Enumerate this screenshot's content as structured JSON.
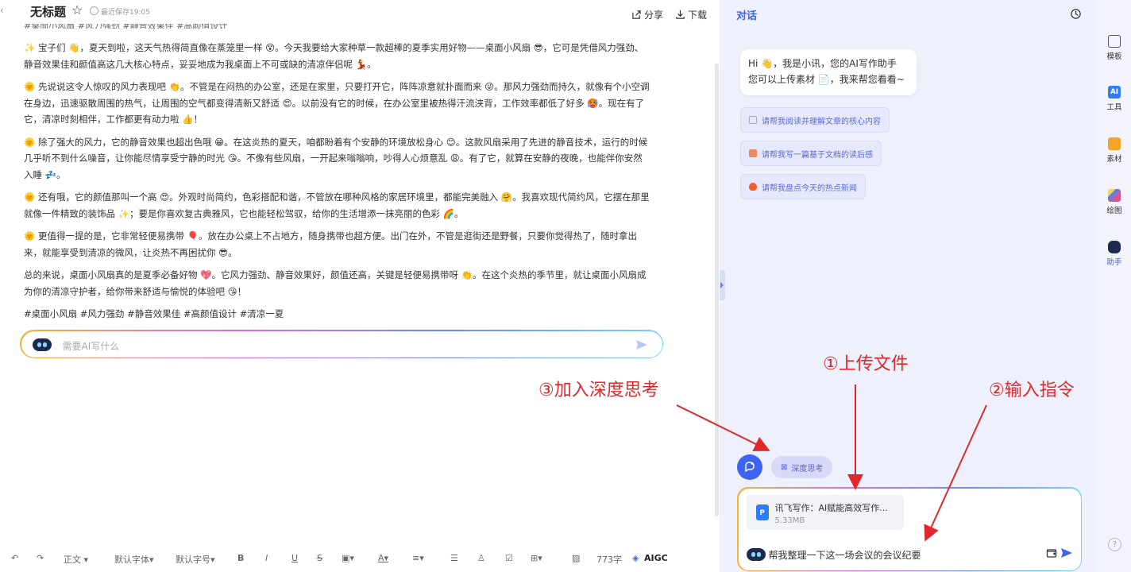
{
  "editor": {
    "title": "无标题",
    "save_note": "最近保存19:05",
    "share_label": "分享",
    "download_label": "下载",
    "cut_line": "#桌面小风扇 #风力强劲 #静音效果佳 #高颜值设计",
    "paragraphs": [
      "✨ 宝子们 👋，夏天到啦，这天气热得简直像在蒸笼里一样 😵。今天我要给大家种草一款超棒的夏季实用好物——桌面小风扇 😎，它可是凭借风力强劲、静音效果佳和颜值高这几大核心特点，妥妥地成为我桌面上不可或缺的清凉伴侣呢 💃。",
      "🌞 先说说这令人惊叹的风力表现吧 👏。不管是在闷热的办公室，还是在家里，只要打开它，阵阵凉意就扑面而来 😜。那风力强劲而持久，就像有个小空调在身边，迅速驱散周围的热气，让周围的空气都变得清新又舒适 😍。以前没有它的时候，在办公室里被热得汗流浃背，工作效率都低了好多 🥵。现在有了它，清凉时刻相伴，工作都更有动力啦 👍！",
      "🌞 除了强大的风力，它的静音效果也超出色哦 😁。在这炎热的夏天，咱都盼着有个安静的环境放松身心 😊。这款风扇采用了先进的静音技术，运行的时候几乎听不到什么噪音，让你能尽情享受宁静的时光 😘。不像有些风扇，一开起来嗡嗡响，吵得人心烦意乱 😩。有了它，就算在安静的夜晚，也能伴你安然入睡 💤。",
      "🌞 还有哦，它的颜值那叫一个高 😍。外观时尚简约，色彩搭配和谐，不管放在哪种风格的家居环境里，都能完美融入 🤗。我喜欢现代简约风，它摆在那里就像一件精致的装饰品 ✨；要是你喜欢复古典雅风，它也能轻松驾驭，给你的生活增添一抹亮丽的色彩 🌈。",
      "🌞 更值得一提的是，它非常轻便易携带 🎈。放在办公桌上不占地方，随身携带也超方便。出门在外，不管是逛街还是野餐，只要你觉得热了，随时拿出来，就能享受到清凉的微风，让炎热不再困扰你 😎。",
      "总的来说，桌面小风扇真的是夏季必备好物 💖。它风力强劲、静音效果好，颜值还高，关键是轻便易携带呀 👏。在这个炎热的季节里，就让桌面小风扇成为你的清凉守护者，给你带来舒适与愉悦的体验吧 😘！",
      "#桌面小风扇 #风力强劲 #静音效果佳 #高颜值设计 #清凉一夏"
    ],
    "ai_placeholder": "需要AI写什么",
    "toolbar": {
      "paragraph_style": "正文",
      "font_family": "默认字体",
      "font_size": "默认字号",
      "bold": "B",
      "italic": "I",
      "underline": "U",
      "strike": "S",
      "word_count": "773字",
      "aigc": "AIGC"
    }
  },
  "chat": {
    "title": "对话",
    "greeting_line1": "Hi 👋，我是小讯，您的AI写作助手",
    "greeting_line2": "您可以上传素材 📄，我来帮您看看~",
    "suggestions": [
      "请帮我阅读并理解文章的核心内容",
      "请帮我写一篇基于文档的读后感",
      "请帮我盘点今天的热点新闻"
    ],
    "deep_think_label": "深度思考",
    "file": {
      "name": "讯飞写作：AI赋能高效写作...",
      "size": "5.33MB",
      "icon_letter": "P"
    },
    "message": "帮我整理一下这一场会议的会议纪要"
  },
  "rail": {
    "items": [
      "模板",
      "工具",
      "素材",
      "绘图",
      "助手"
    ],
    "ai_badge": "AI",
    "help": "?"
  },
  "annotations": {
    "upload": "①上传文件",
    "input": "②输入指令",
    "deep": "③加入深度思考"
  },
  "colors": {
    "accent": "#3d63f0",
    "annotation": "#e0282c",
    "panel_bg": "#eef0fb"
  }
}
